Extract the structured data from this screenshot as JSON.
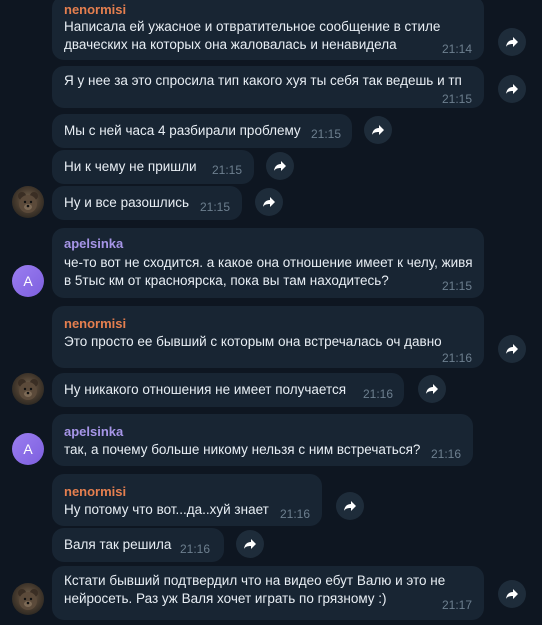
{
  "colors": {
    "nenormisi": "#e57f4f",
    "apelsinka": "#a695e7"
  },
  "messages": [
    {
      "sender": "nenormisi",
      "lines": [
        "Написала ей ужасное и отвратительное сообщение в стиле",
        "дваческих на которых она жаловалась и ненавидела"
      ],
      "time": "21:14"
    },
    {
      "lines": [
        "Я у нее за это спросила тип какого хуя ты себя так ведешь и тп"
      ],
      "time": "21:15"
    },
    {
      "lines": [
        "Мы с ней часа 4 разбирали проблему"
      ],
      "time": "21:15"
    },
    {
      "lines": [
        "Ни к чему не пришли"
      ],
      "time": "21:15"
    },
    {
      "lines": [
        "Ну и все разошлись"
      ],
      "time": "21:15"
    },
    {
      "sender": "apelsinka",
      "avatar_letter": "A",
      "lines": [
        "че-то вот не сходится. а какое она отношение имеет к челу, живя",
        "в 5тыс км от красноярска, пока вы там находитесь?"
      ],
      "time": "21:15"
    },
    {
      "sender": "nenormisi",
      "lines": [
        "Это просто ее бывший с которым она встречалась оч давно"
      ],
      "time": "21:16"
    },
    {
      "lines": [
        "Ну никакого отношения не имеет получается"
      ],
      "time": "21:16"
    },
    {
      "sender": "apelsinka",
      "avatar_letter": "A",
      "lines": [
        "так, а почему больше никому нельзя с ним встречаться?"
      ],
      "time": "21:16"
    },
    {
      "sender": "nenormisi",
      "lines": [
        "Ну потому что вот...да..хуй знает"
      ],
      "time": "21:16"
    },
    {
      "lines": [
        "Валя так решила"
      ],
      "time": "21:16"
    },
    {
      "lines": [
        "Кстати бывший подтвердил что на видео ебут Валю и это не",
        "нейросеть. Раз уж Валя хочет играть по грязному :)"
      ],
      "time": "21:17"
    }
  ]
}
